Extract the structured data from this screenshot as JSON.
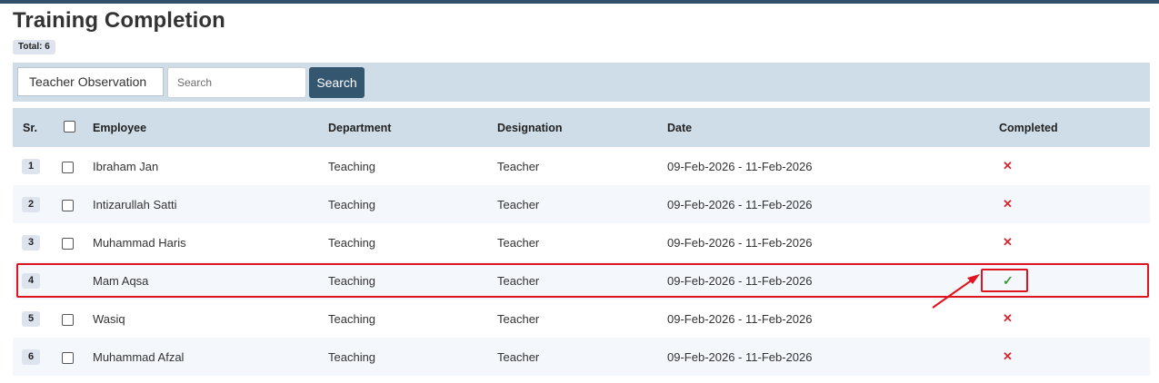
{
  "page": {
    "title": "Training Completion",
    "total_label": "Total: 6"
  },
  "filters": {
    "training_select": "Teacher Observation",
    "search_placeholder": "Search",
    "search_button": "Search"
  },
  "table": {
    "headers": {
      "sr": "Sr.",
      "employee": "Employee",
      "department": "Department",
      "designation": "Designation",
      "date": "Date",
      "completed": "Completed"
    },
    "rows": [
      {
        "sr": "1",
        "employee": "Ibraham Jan",
        "department": "Teaching",
        "designation": "Teacher",
        "date": "09-Feb-2026 - 11-Feb-2026",
        "completed": false,
        "has_checkbox": true
      },
      {
        "sr": "2",
        "employee": "Intizarullah Satti",
        "department": "Teaching",
        "designation": "Teacher",
        "date": "09-Feb-2026 - 11-Feb-2026",
        "completed": false,
        "has_checkbox": true
      },
      {
        "sr": "3",
        "employee": "Muhammad Haris",
        "department": "Teaching",
        "designation": "Teacher",
        "date": "09-Feb-2026 - 11-Feb-2026",
        "completed": false,
        "has_checkbox": true
      },
      {
        "sr": "4",
        "employee": "Mam Aqsa",
        "department": "Teaching",
        "designation": "Teacher",
        "date": "09-Feb-2026 - 11-Feb-2026",
        "completed": true,
        "has_checkbox": false
      },
      {
        "sr": "5",
        "employee": "Wasiq",
        "department": "Teaching",
        "designation": "Teacher",
        "date": "09-Feb-2026 - 11-Feb-2026",
        "completed": false,
        "has_checkbox": true
      },
      {
        "sr": "6",
        "employee": "Muhammad Afzal",
        "department": "Teaching",
        "designation": "Teacher",
        "date": "09-Feb-2026 - 11-Feb-2026",
        "completed": false,
        "has_checkbox": true
      }
    ]
  },
  "icons": {
    "not_completed": "cross-icon",
    "completed": "check-icon"
  },
  "colors": {
    "header_bg": "#cfdde8",
    "button_bg": "#34566f",
    "cross": "#d8262f",
    "check": "#3a9a3a",
    "annotation": "#e0141e"
  }
}
